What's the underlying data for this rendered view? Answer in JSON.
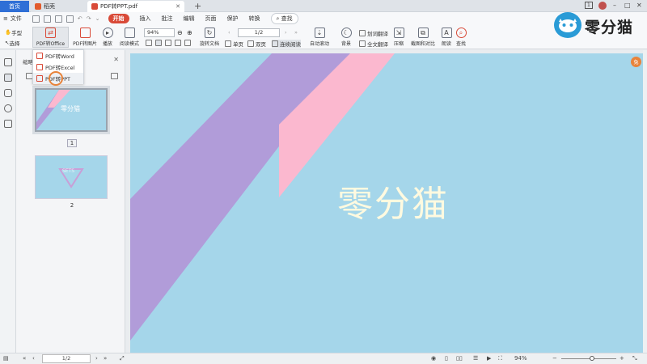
{
  "tabs": {
    "home": "首页",
    "shell": "稻壳",
    "doc": "PDF转PPT.pdf",
    "plus": "+"
  },
  "window": {
    "page_badge": "1",
    "minimize": "–",
    "restore": "□",
    "close": "✕"
  },
  "menu": {
    "file": "文件",
    "items": [
      "开始",
      "插入",
      "批注",
      "编辑",
      "页面",
      "保护",
      "转换"
    ],
    "search": "查找"
  },
  "ribbon": {
    "hand": "手型",
    "select": "选择",
    "pdf_to_office": "PDF转Office",
    "pdf_to_image": "PDF转图片",
    "play": "播放",
    "read_mode": "阅读模式",
    "zoom": "94%",
    "rotate": "旋转文档",
    "page": "1/2",
    "single": "单页",
    "double": "双页",
    "continuous": "连续阅读",
    "auto_scroll": "自动滚动",
    "background": "背景",
    "word_translate": "划词翻译",
    "full_translate": "全文翻译",
    "compress": "压缩",
    "screenshot_compare": "截图和对比",
    "read_aloud": "朗读",
    "find": "查找"
  },
  "dropdown": {
    "items": [
      "PDF转Word",
      "PDF转Excel",
      "PDF转PPT"
    ]
  },
  "panel": {
    "header": "缩略",
    "thumb1_text": "零分猫",
    "thumb2_text": "SETS",
    "page1": "1",
    "page2": "2"
  },
  "document": {
    "title": "零分猫"
  },
  "logo": {
    "text": "零分猫"
  },
  "badge": {
    "text": "兔"
  },
  "status": {
    "page": "1/2",
    "zoom": "94%",
    "zoom_minus": "−",
    "zoom_plus": "+"
  },
  "colors": {
    "page_bg": "#a5d6ea",
    "purple_band": "#b19cd9",
    "pink_band": "#fbb8cf",
    "title": "#fffae0",
    "accent": "#d94a38"
  }
}
